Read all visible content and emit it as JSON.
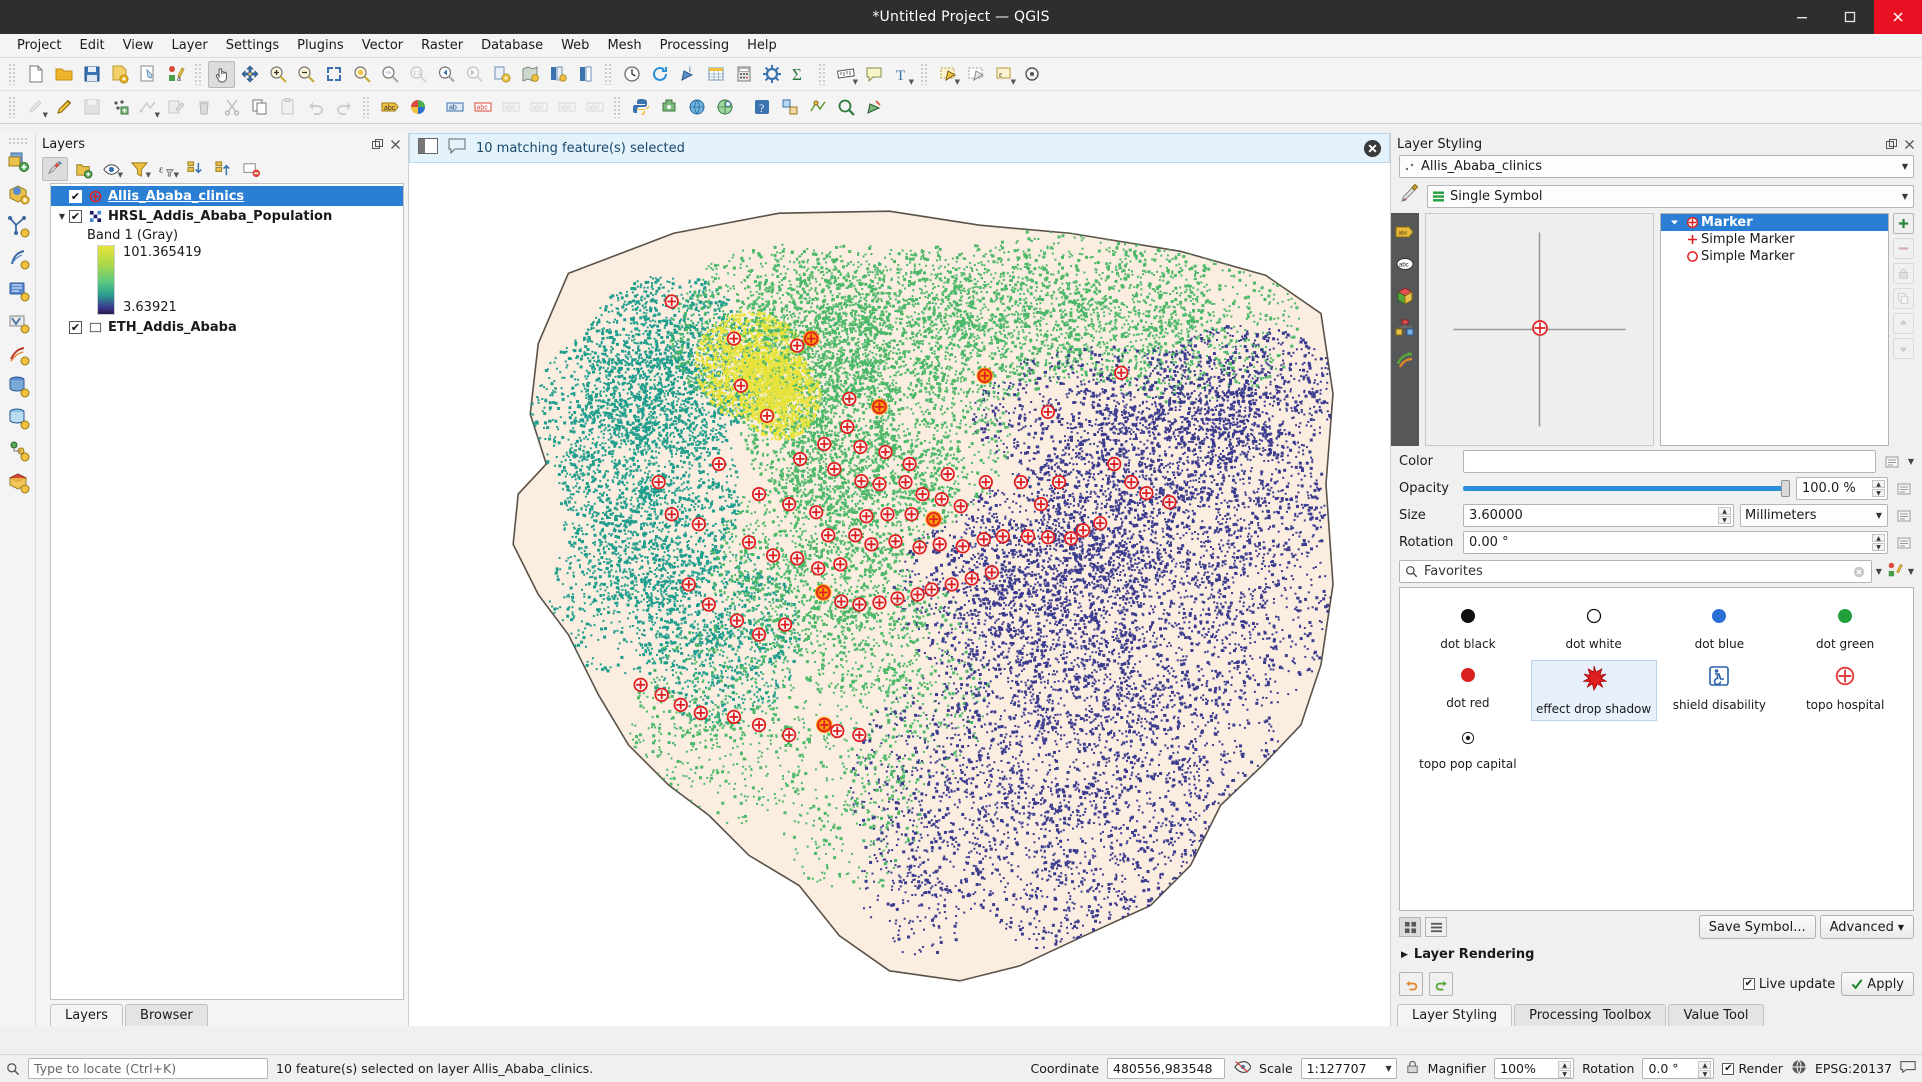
{
  "window": {
    "title": "*Untitled Project — QGIS",
    "minimize_label": "—",
    "maximize_label": "□",
    "close_label": "✕"
  },
  "menu": [
    {
      "label": "Project"
    },
    {
      "label": "Edit"
    },
    {
      "label": "View"
    },
    {
      "label": "Layer"
    },
    {
      "label": "Settings"
    },
    {
      "label": "Plugins"
    },
    {
      "label": "Vector"
    },
    {
      "label": "Raster"
    },
    {
      "label": "Database"
    },
    {
      "label": "Web"
    },
    {
      "label": "Mesh"
    },
    {
      "label": "Processing"
    },
    {
      "label": "Help"
    }
  ],
  "toolbar_top": [
    {
      "name": "new-project-icon"
    },
    {
      "name": "open-project-icon"
    },
    {
      "name": "save-project-icon"
    },
    {
      "name": "save-project-as-icon"
    },
    {
      "name": "new-print-layout-icon"
    },
    {
      "name": "style-manager-icon"
    },
    {
      "name": "pan-map-icon"
    },
    {
      "name": "pan-to-selection-icon"
    },
    {
      "name": "zoom-in-icon"
    },
    {
      "name": "zoom-out-icon"
    },
    {
      "name": "zoom-full-icon"
    },
    {
      "name": "zoom-to-selection-icon"
    },
    {
      "name": "zoom-to-layer-icon"
    },
    {
      "name": "zoom-native-icon"
    },
    {
      "name": "zoom-last-icon"
    },
    {
      "name": "zoom-next-icon"
    },
    {
      "name": "refresh-icon"
    },
    {
      "name": "new-map-view-icon"
    },
    {
      "name": "new-3d-map-view-icon"
    },
    {
      "name": "show-bookmarks-icon"
    },
    {
      "name": "new-bookmark-icon"
    },
    {
      "name": "identify-features-icon"
    },
    {
      "name": "open-attribute-table-icon"
    },
    {
      "name": "field-calculator-icon"
    },
    {
      "name": "processing-toolbox-icon"
    },
    {
      "name": "statistical-summary-icon"
    },
    {
      "name": "measure-line-icon"
    },
    {
      "name": "map-tips-icon"
    },
    {
      "name": "new-text-annotation-icon"
    },
    {
      "name": "select-features-icon"
    },
    {
      "name": "deselect-features-icon"
    },
    {
      "name": "select-by-expression-icon"
    },
    {
      "name": "select-value-icon"
    }
  ],
  "toolbar_second": [
    {
      "name": "current-edits-icon"
    },
    {
      "name": "toggle-editing-icon"
    },
    {
      "name": "save-layer-edits-icon"
    },
    {
      "name": "add-point-feature-icon"
    },
    {
      "name": "vertex-tool-icon"
    },
    {
      "name": "modify-attributes-icon"
    },
    {
      "name": "delete-selected-icon"
    },
    {
      "name": "cut-features-icon"
    },
    {
      "name": "copy-features-icon"
    },
    {
      "name": "paste-features-icon"
    },
    {
      "name": "undo-icon"
    },
    {
      "name": "redo-icon"
    },
    {
      "name": "label-layer-icon"
    },
    {
      "name": "diagram-layer-icon"
    },
    {
      "name": "highlight-pinned-labels-icon"
    },
    {
      "name": "show-hide-labels-icon"
    },
    {
      "name": "pin-labels-icon"
    },
    {
      "name": "move-label-icon"
    },
    {
      "name": "rotate-label-icon"
    },
    {
      "name": "change-label-icon"
    },
    {
      "name": "python-console-icon"
    },
    {
      "name": "plugin-manager-icon"
    },
    {
      "name": "osm-web-icon"
    },
    {
      "name": "metasearch-icon"
    },
    {
      "name": "georeferencer-icon"
    },
    {
      "name": "help-contents-icon"
    },
    {
      "name": "topology-checker-icon"
    },
    {
      "name": "geometry-checker-icon"
    },
    {
      "name": "qgis2web-icon"
    },
    {
      "name": "semi-automatic-classification-icon"
    }
  ],
  "left_toolbar": [
    {
      "name": "add-delimited-text-layer-icon"
    },
    {
      "name": "add-wms-layer-icon"
    },
    {
      "name": "add-vector-layer-icon"
    },
    {
      "name": "add-raster-layer-icon"
    },
    {
      "name": "add-mesh-layer-icon"
    },
    {
      "name": "add-wfs-layer-icon"
    },
    {
      "name": "add-postgis-layer-icon"
    },
    {
      "name": "add-spatialite-layer-icon"
    },
    {
      "name": "add-virtual-layer-icon"
    },
    {
      "name": "add-arcgis-layer-icon"
    },
    {
      "name": "add-pointcloud-layer-icon"
    },
    {
      "name": "new-shapefile-layer-icon"
    }
  ],
  "layers_panel": {
    "title": "Layers",
    "toolbar": [
      {
        "name": "open-layer-styling-panel-icon",
        "active": true
      },
      {
        "name": "add-group-icon",
        "active": false
      },
      {
        "name": "manage-layer-visibility-icon",
        "active": false
      },
      {
        "name": "filter-legend-icon",
        "active": false
      },
      {
        "name": "expression-filter-icon",
        "active": false
      },
      {
        "name": "expand-all-icon",
        "active": false
      },
      {
        "name": "collapse-all-icon",
        "active": false
      },
      {
        "name": "remove-layer-icon",
        "active": false
      }
    ],
    "layers": [
      {
        "name": "Allis_Ababa_clinics",
        "checked": true,
        "selected": true,
        "icon": "point-layer-icon",
        "expandable": false
      },
      {
        "name": "HRSL_Addis_Ababa_Population",
        "checked": true,
        "selected": false,
        "icon": "raster-layer-icon",
        "expandable": true,
        "band_label": "Band 1 (Gray)",
        "ramp_max": "101.365419",
        "ramp_min": "3.63921"
      },
      {
        "name": "ETH_Addis_Ababa",
        "checked": true,
        "selected": false,
        "icon": "polygon-layer-icon",
        "expandable": false
      }
    ],
    "tabs": [
      {
        "label": "Layers",
        "active": true
      },
      {
        "label": "Browser",
        "active": false
      }
    ]
  },
  "message_bar": {
    "text": "10 matching feature(s) selected",
    "close_label": "✕"
  },
  "layer_styling": {
    "title": "Layer Styling",
    "layer_combo": "Allis_Ababa_clinics",
    "renderer_combo": "Single Symbol",
    "symbol_tree": [
      {
        "label": "Marker",
        "level": 0,
        "selected": true,
        "icon": "marker-group-icon"
      },
      {
        "label": "Simple Marker",
        "level": 1,
        "selected": false,
        "icon": "cross-marker-icon"
      },
      {
        "label": "Simple Marker",
        "level": 1,
        "selected": false,
        "icon": "circle-marker-icon"
      }
    ],
    "properties": {
      "color_label": "Color",
      "color_value": "#ffffff",
      "opacity_label": "Opacity",
      "opacity_value": "100.0 %",
      "size_label": "Size",
      "size_value": "3.60000",
      "size_unit": "Millimeters",
      "rotation_label": "Rotation",
      "rotation_value": "0.00 °"
    },
    "search_placeholder": "Favorites",
    "gallery": [
      {
        "label": "dot  black",
        "icon": "dot-black-icon",
        "color": "#111111",
        "shape": "filled-circle"
      },
      {
        "label": "dot  white",
        "icon": "dot-white-icon",
        "color": "#ffffff",
        "shape": "hollow-circle"
      },
      {
        "label": "dot blue",
        "icon": "dot-blue-icon",
        "color": "#2a6fd4",
        "shape": "filled-circle"
      },
      {
        "label": "dot green",
        "icon": "dot-green-icon",
        "color": "#22a03c",
        "shape": "filled-circle"
      },
      {
        "label": "dot red",
        "icon": "dot-red-icon",
        "color": "#d82020",
        "shape": "filled-circle"
      },
      {
        "label": "effect drop shadow",
        "icon": "effect-drop-shadow-icon",
        "color": "#e02020",
        "shape": "starburst"
      },
      {
        "label": "shield disability",
        "icon": "shield-disability-icon",
        "color": "#2a5fa8",
        "shape": "shield"
      },
      {
        "label": "topo hospital",
        "icon": "topo-hospital-icon",
        "color": "#e23b3b",
        "shape": "cross-circle"
      },
      {
        "label": "topo pop capital",
        "icon": "topo-pop-capital-icon",
        "color": "#222222",
        "shape": "dot-circle"
      }
    ],
    "footer": {
      "list_view_icon": "grid-view-icon",
      "icon_view_icon": "list-view-icon",
      "save_symbol_label": "Save Symbol...",
      "advanced_label": "Advanced",
      "layer_rendering_label": "Layer Rendering",
      "undo_icon": "undo-icon",
      "redo_icon": "redo-icon",
      "live_update_label": "Live update",
      "live_update_checked": true,
      "apply_label": "Apply"
    },
    "tabs": [
      {
        "label": "Layer Styling",
        "active": true
      },
      {
        "label": "Processing Toolbox",
        "active": false
      },
      {
        "label": "Value Tool",
        "active": false
      }
    ]
  },
  "statusbar": {
    "locator_placeholder": "Type to locate (Ctrl+K)",
    "selection_message": "10 feature(s) selected on layer Allis_Ababa_clinics.",
    "coordinate_label": "Coordinate",
    "coordinate_value": "480556,983548",
    "scale_label": "Scale",
    "scale_value": "1:127707",
    "magnifier_label": "Magnifier",
    "magnifier_value": "100%",
    "rotation_label": "Rotation",
    "rotation_value": "0.0 °",
    "render_label": "Render",
    "render_checked": true,
    "crs_label": "EPSG:20137"
  },
  "map": {
    "boundary_fill": "#fbeee0",
    "boundary_stroke": "#5a5248",
    "cluster_colors": {
      "yellow": "#e8e33c",
      "green": "#4cb86a",
      "teal": "#1f9e8e",
      "blue": "#3b3b8f"
    },
    "clinic_marker_color": "#e02020",
    "selected_marker_color": "#ff9a00"
  }
}
